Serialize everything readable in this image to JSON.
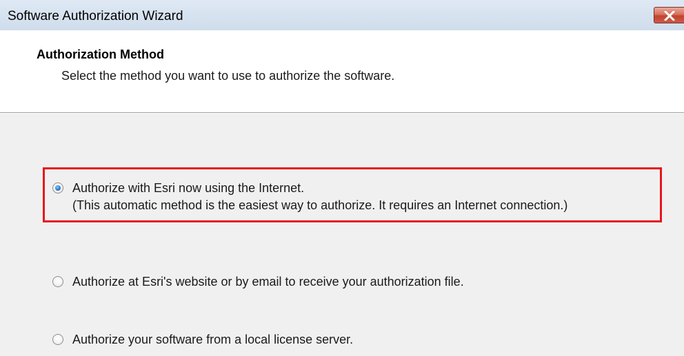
{
  "window": {
    "title": "Software Authorization Wizard",
    "close_icon": "close-icon"
  },
  "header": {
    "title": "Authorization Method",
    "subtitle": "Select the method you want to use to authorize the software."
  },
  "options": [
    {
      "label": "Authorize with Esri now using the Internet.",
      "description": "(This automatic method is the easiest way to authorize. It requires an Internet connection.)",
      "selected": true
    },
    {
      "label": "Authorize at Esri's website or by email to receive your authorization file.",
      "selected": false
    },
    {
      "label": "Authorize your software from a local license server.",
      "selected": false
    }
  ],
  "colors": {
    "highlight": "#e8141b",
    "panel_bg": "#f0f0f0",
    "titlebar_bg": "#d6e2ef",
    "close_button": "#c9503c"
  }
}
